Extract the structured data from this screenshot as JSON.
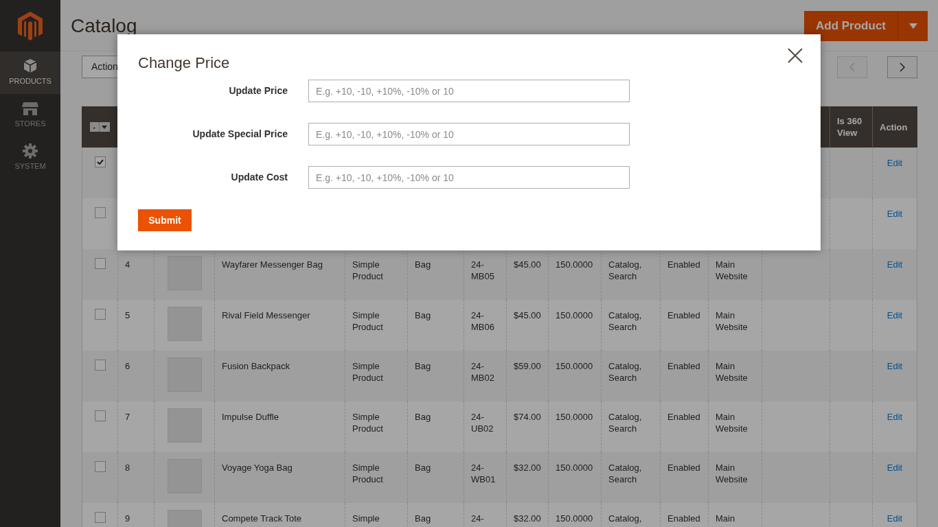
{
  "sidebar": {
    "items": [
      {
        "label": "PRODUCTS",
        "kind": "box",
        "selected": true
      },
      {
        "label": "STORES",
        "kind": "store",
        "selected": false
      },
      {
        "label": "SYSTEM",
        "kind": "gear",
        "selected": false
      }
    ]
  },
  "page": {
    "title": "Catalog",
    "add_button": "Add Product",
    "actions_select": "Action"
  },
  "table": {
    "mass_select": "-",
    "columns": [
      {
        "label": "Is 360 View"
      },
      {
        "label": "Action"
      }
    ],
    "rows": [
      {
        "checked": true,
        "action": "Edit"
      },
      {
        "checked": false,
        "action": "Edit"
      },
      {
        "checked": false,
        "id": "4",
        "name": "Wayfarer Messenger Bag",
        "type": "Simple Product",
        "attribute_set": "Bag",
        "sku": "24-MB05",
        "price": "$45.00",
        "quantity": "150.0000",
        "visibility": "Catalog, Search",
        "status": "Enabled",
        "websites": "Main Website",
        "action": "Edit"
      },
      {
        "checked": false,
        "id": "5",
        "name": "Rival Field Messenger",
        "type": "Simple Product",
        "attribute_set": "Bag",
        "sku": "24-MB06",
        "price": "$45.00",
        "quantity": "150.0000",
        "visibility": "Catalog, Search",
        "status": "Enabled",
        "websites": "Main Website",
        "action": "Edit"
      },
      {
        "checked": false,
        "id": "6",
        "name": "Fusion Backpack",
        "type": "Simple Product",
        "attribute_set": "Bag",
        "sku": "24-MB02",
        "price": "$59.00",
        "quantity": "150.0000",
        "visibility": "Catalog, Search",
        "status": "Enabled",
        "websites": "Main Website",
        "action": "Edit"
      },
      {
        "checked": false,
        "id": "7",
        "name": "Impulse Duffle",
        "type": "Simple Product",
        "attribute_set": "Bag",
        "sku": "24-UB02",
        "price": "$74.00",
        "quantity": "150.0000",
        "visibility": "Catalog, Search",
        "status": "Enabled",
        "websites": "Main Website",
        "action": "Edit"
      },
      {
        "checked": false,
        "id": "8",
        "name": "Voyage Yoga Bag",
        "type": "Simple Product",
        "attribute_set": "Bag",
        "sku": "24-WB01",
        "price": "$32.00",
        "quantity": "150.0000",
        "visibility": "Catalog, Search",
        "status": "Enabled",
        "websites": "Main Website",
        "action": "Edit"
      },
      {
        "checked": false,
        "id": "9",
        "name": "Compete Track Tote",
        "type": "Simple",
        "attribute_set": "Bag",
        "sku": "24-",
        "price": "$32.00",
        "quantity": "150.0000",
        "visibility": "Catalog,",
        "status": "Enabled",
        "websites": "Main",
        "action": "Edit"
      }
    ]
  },
  "modal": {
    "title": "Change Price",
    "fields": [
      {
        "label": "Update Price",
        "placeholder": "E.g. +10, -10, +10%, -10% or 10"
      },
      {
        "label": "Update Special Price",
        "placeholder": "E.g. +10, -10, +10%, -10% or 10"
      },
      {
        "label": "Update Cost",
        "placeholder": "E.g. +10, -10, +10%, -10% or 10"
      }
    ],
    "submit": "Submit"
  }
}
